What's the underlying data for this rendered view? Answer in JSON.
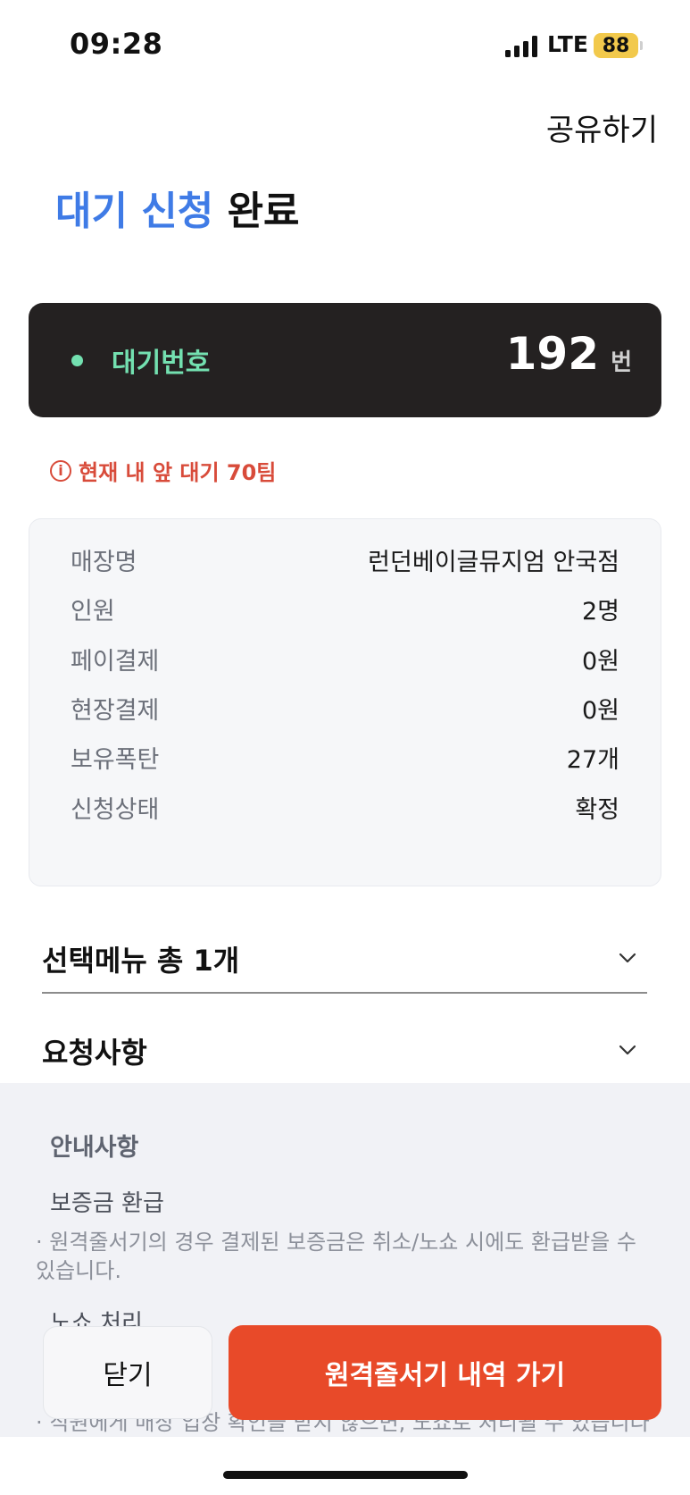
{
  "status_bar": {
    "time": "09:28",
    "network": "LTE",
    "battery": "88"
  },
  "header": {
    "share_label": "공유하기"
  },
  "title": {
    "accent": "대기 신청",
    "rest": " 완료"
  },
  "ticket": {
    "label": "대기번호",
    "number": "192",
    "unit": "번"
  },
  "alert": {
    "icon": "i",
    "text": "현재 내 앞 대기 70팀"
  },
  "details": [
    {
      "label": "매장명",
      "value": "런던베이글뮤지엄 안국점"
    },
    {
      "label": "인원",
      "value": "2명"
    },
    {
      "label": "페이결제",
      "value": "0원"
    },
    {
      "label": "현장결제",
      "value": "0원"
    },
    {
      "label": "보유폭탄",
      "value": "27개"
    },
    {
      "label": "신청상태",
      "value": "확정"
    }
  ],
  "sections": {
    "menu": "선택메뉴 총 1개",
    "request": "요청사항"
  },
  "notice": {
    "title": "안내사항",
    "deposit_title": "보증금 환급",
    "deposit_text": "· 원격줄서기의 경우 결제된 보증금은 취소/노쇼 시에도 환급받을 수 있습니다.",
    "noshow_title": "노쇼 처리",
    "noshow_text": "· 직원에게 매장 입장 확인을 받지 않으면, 노쇼로 처리될 수 있습니다"
  },
  "buttons": {
    "close": "닫기",
    "go": "원격줄서기 내역 가기"
  },
  "colors": {
    "accent": "#3f7be6",
    "ticket_bg": "#242121",
    "ticket_label": "#73e0b0",
    "alert": "#d84b3a",
    "primary_button": "#e84a29"
  }
}
